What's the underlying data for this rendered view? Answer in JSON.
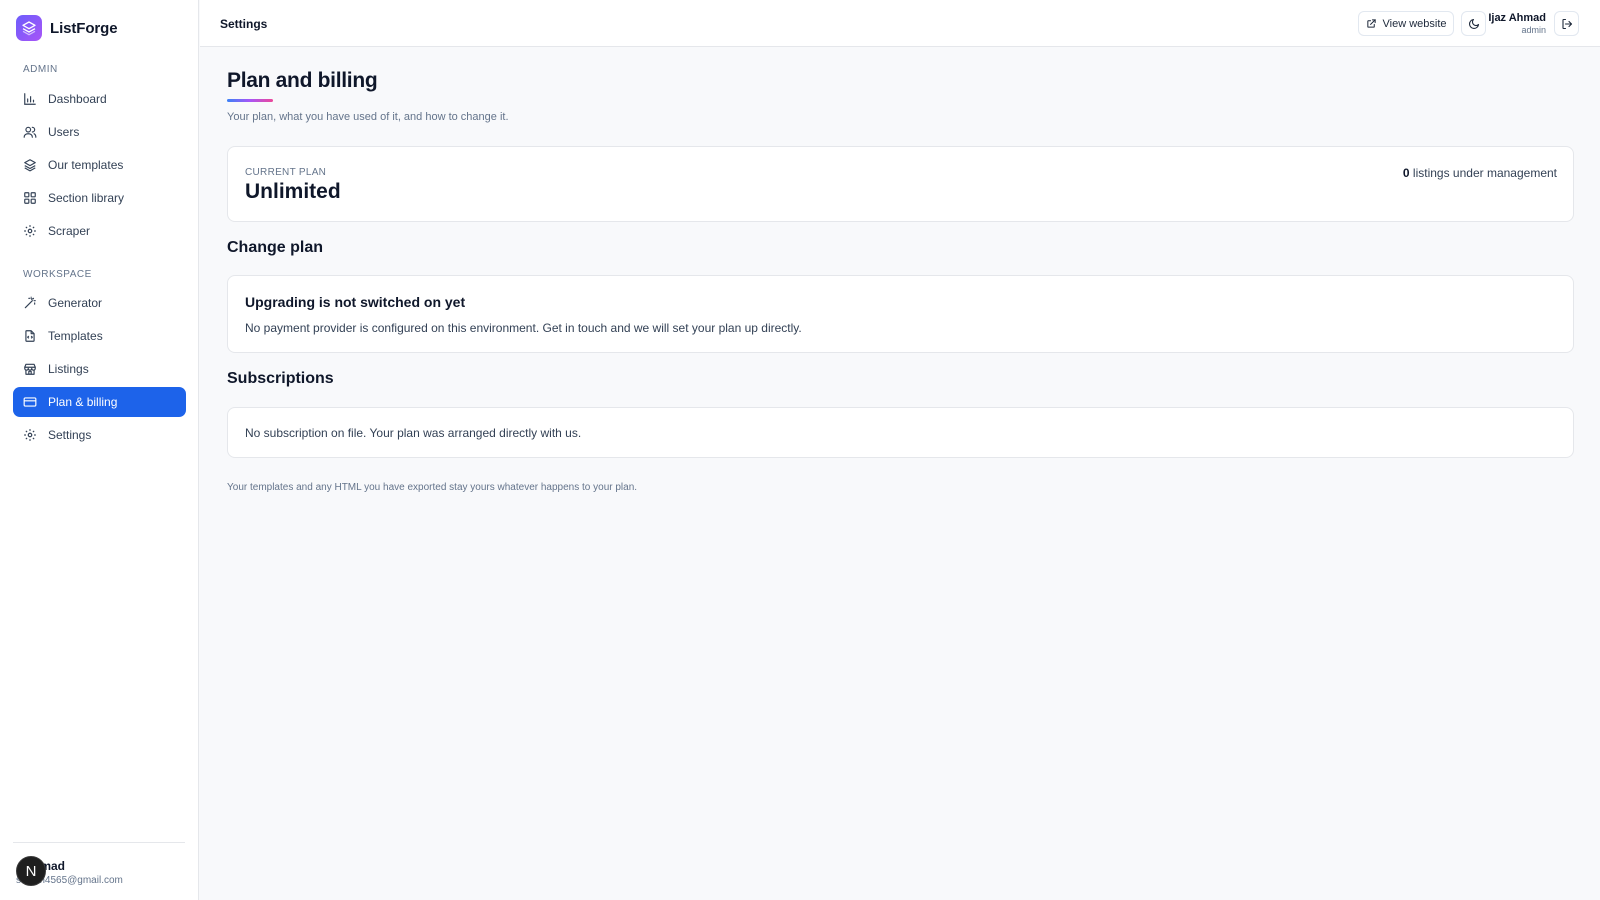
{
  "brand": {
    "name": "ListForge"
  },
  "sidebar": {
    "groups": [
      {
        "label": "ADMIN",
        "items": [
          {
            "label": "Dashboard",
            "icon": "bar-chart-icon"
          },
          {
            "label": "Users",
            "icon": "users-icon"
          },
          {
            "label": "Our templates",
            "icon": "layers-icon"
          },
          {
            "label": "Section library",
            "icon": "grid-icon"
          },
          {
            "label": "Scraper",
            "icon": "gear-icon"
          }
        ]
      },
      {
        "label": "WORKSPACE",
        "items": [
          {
            "label": "Generator",
            "icon": "magic-wand-icon"
          },
          {
            "label": "Templates",
            "icon": "file-code-icon"
          },
          {
            "label": "Listings",
            "icon": "storefront-icon"
          },
          {
            "label": "Plan & billing",
            "icon": "credit-card-icon",
            "active": true
          },
          {
            "label": "Settings",
            "icon": "gear-icon"
          }
        ]
      }
    ],
    "user": {
      "avatar_initial": "N",
      "name": "hmad",
      "email": "sajjam4565@gmail.com"
    }
  },
  "topbar": {
    "title": "Settings",
    "view_website_label": "View website",
    "user_name": "Ijaz Ahmad",
    "user_role": "admin"
  },
  "page": {
    "title": "Plan and billing",
    "subtitle": "Your plan, what you have used of it, and how to change it.",
    "current_plan_label": "CURRENT PLAN",
    "current_plan_name": "Unlimited",
    "listings_count": "0",
    "listings_label": " listings under management",
    "change_plan_title": "Change plan",
    "upgrade_title": "Upgrading is not switched on yet",
    "upgrade_text": "No payment provider is configured on this environment. Get in touch and we will set your plan up directly.",
    "subscriptions_title": "Subscriptions",
    "subscriptions_text": "No subscription on file. Your plan was arranged directly with us.",
    "footnote": "Your templates and any HTML you have exported stay yours whatever happens to your plan."
  },
  "colors": {
    "accent": "#1d63ea",
    "brand_gradient_start": "#6d5dfc",
    "brand_gradient_end": "#a855f7",
    "background": "#f8f9fb"
  }
}
